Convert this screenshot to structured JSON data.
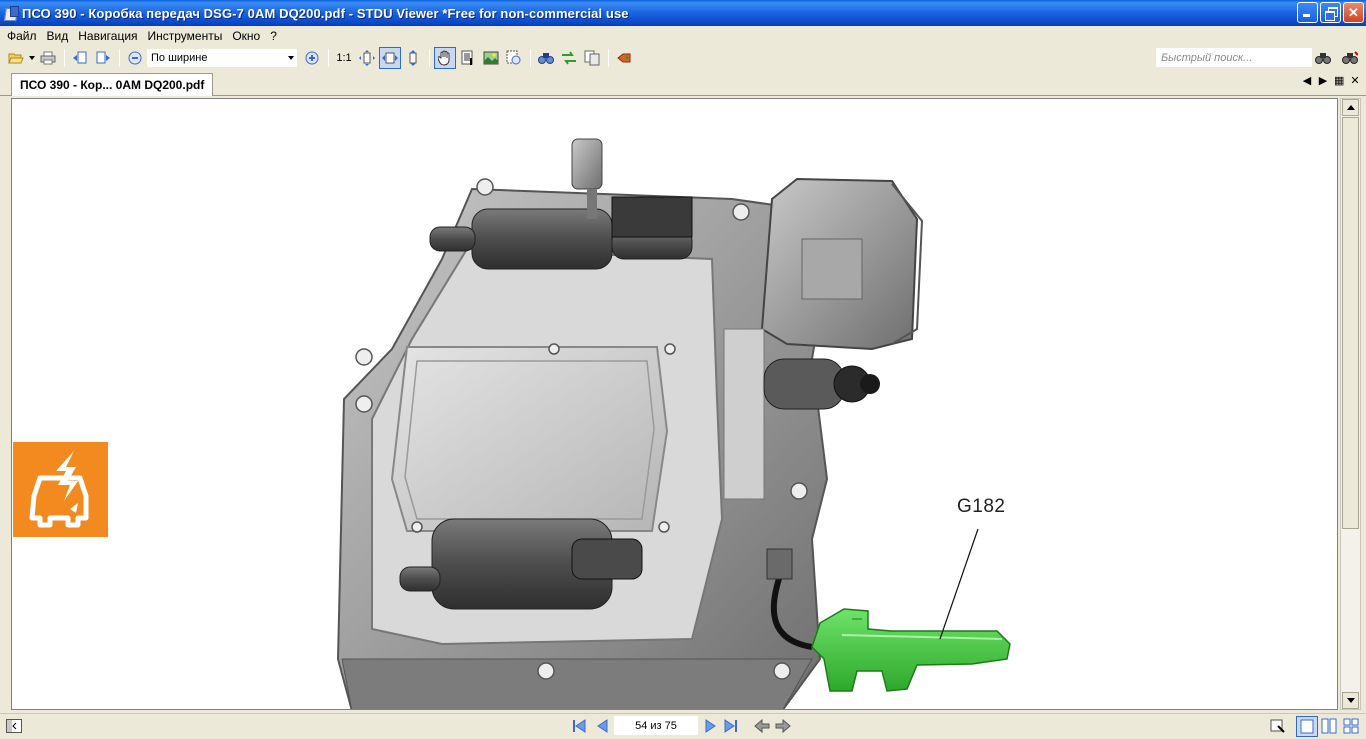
{
  "window": {
    "title": "ПСО 390 - Коробка передач DSG-7 0AM DQ200.pdf - STDU Viewer *Free for non-commercial use"
  },
  "menu": {
    "items": [
      {
        "label": "Файл"
      },
      {
        "label": "Вид"
      },
      {
        "label": "Навигация"
      },
      {
        "label": "Инструменты"
      },
      {
        "label": "Окно"
      },
      {
        "label": "?"
      }
    ]
  },
  "toolbar": {
    "zoom_mode": "По ширине",
    "actual_size_label": "1:1",
    "search_placeholder": "Быстрый поиск..."
  },
  "tabs": [
    {
      "label": "ПСО 390 - Кор... 0AM DQ200.pdf",
      "active": true
    }
  ],
  "document": {
    "callout_label": "G182"
  },
  "status": {
    "page_indicator": "54 из 75"
  },
  "colors": {
    "titlebar": "#0a5fdc",
    "chrome": "#ece9d8",
    "highlight_sensor": "#3cbf37",
    "badge_orange": "#f28a1f"
  },
  "icons": [
    "open-folder-icon",
    "print-icon",
    "zoom-out-icon",
    "zoom-in-icon",
    "hand-tool-icon",
    "text-select-icon",
    "snapshot-icon",
    "find-icon",
    "rotate-icon",
    "bookmark-icon"
  ]
}
